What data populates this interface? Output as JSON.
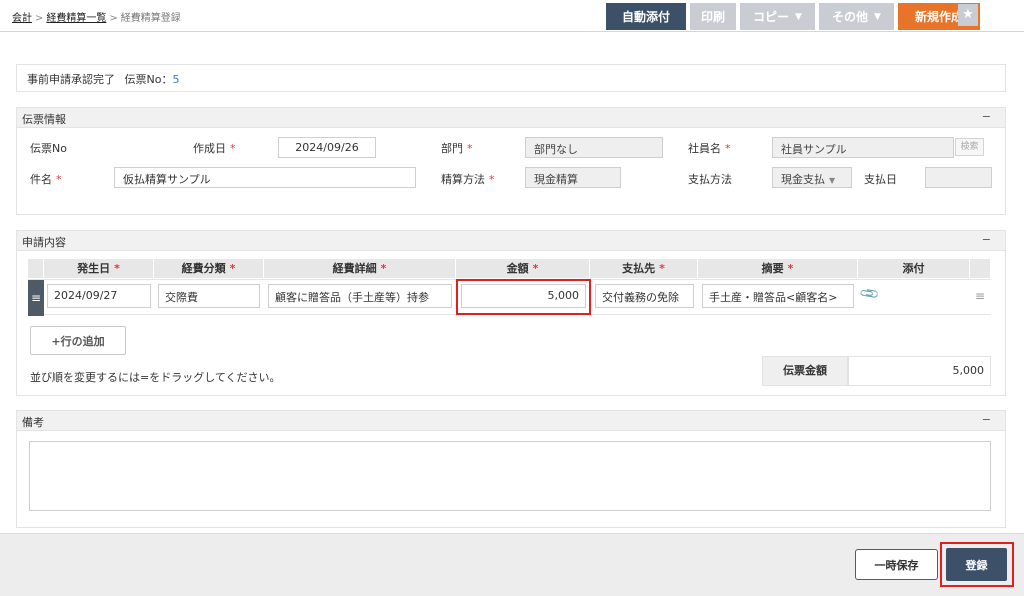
{
  "breadcrumb": {
    "item1": "会計",
    "sep": ">",
    "item2": "経費精算一覧",
    "current": "経費精算登録"
  },
  "toolbar": {
    "auto_attach": "自動添付",
    "print": "印刷",
    "copy": "コピー",
    "other": "その他",
    "new": "新規作成",
    "caret": "▼"
  },
  "star": "★",
  "status": {
    "text": "事前申請承認完了",
    "voucher_label": "伝票No：",
    "voucher_no": "5"
  },
  "voucher_info": {
    "title": "伝票情報",
    "collapse": "−",
    "voucher_no_label": "伝票No",
    "created_label": "作成日",
    "created_value": "2024/09/26",
    "dept_label": "部門",
    "dept_value": "部門なし",
    "emp_label": "社員名",
    "emp_value": "社員サンプル",
    "search_label": "検索",
    "subject_label": "件名",
    "subject_value": "仮払精算サンプル",
    "method_label": "精算方法",
    "method_value": "現金精算",
    "pay_method_label": "支払方法",
    "pay_method_value": "現金支払",
    "pay_date_label": "支払日",
    "pay_date_value": "",
    "required_mark": "*"
  },
  "application": {
    "title": "申請内容",
    "collapse": "−",
    "columns": [
      "発生日",
      "経費分類",
      "経費詳細",
      "金額",
      "支払先",
      "摘要",
      "添付"
    ],
    "row": {
      "date": "2024/09/27",
      "category": "交際費",
      "detail": "顧客に贈答品（手土産等）持参",
      "amount": "5,000",
      "payee": "交付義務の免除",
      "summary": "手土産・贈答品<顧客名>",
      "attach_icon": "📎",
      "handle": "≡",
      "menu": "≡"
    },
    "add_row": "+行の追加",
    "hint": "並び順を変更するには=をドラッグしてください。",
    "total_label": "伝票金額",
    "total_value": "5,000"
  },
  "memo": {
    "title": "備考",
    "collapse": "−"
  },
  "footer": {
    "save": "一時保存",
    "register": "登録"
  }
}
